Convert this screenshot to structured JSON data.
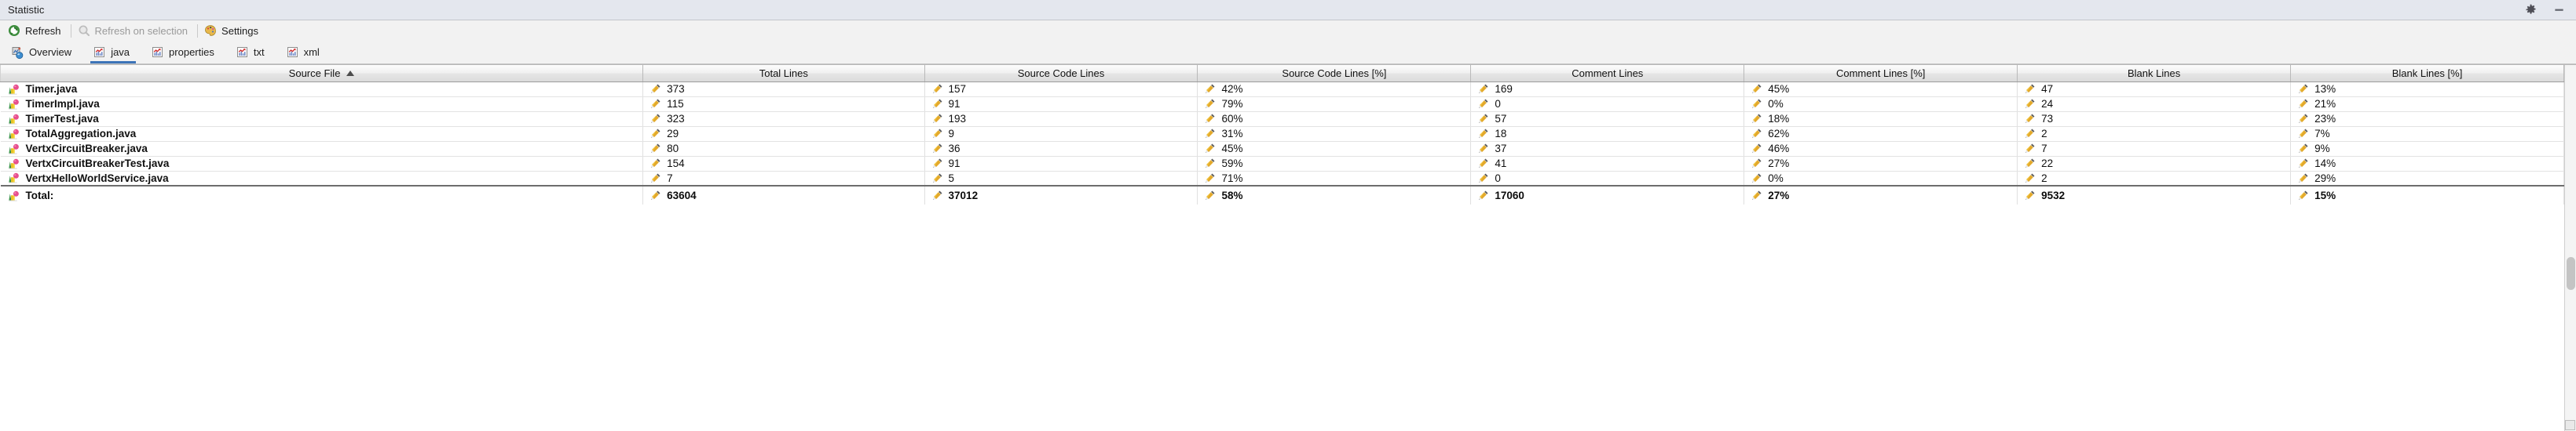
{
  "window": {
    "title": "Statistic",
    "controls": [
      {
        "name": "settings-gear",
        "icon": "gear-icon"
      },
      {
        "name": "minimize",
        "icon": "minimize-icon"
      }
    ]
  },
  "toolbar": {
    "items": [
      {
        "label": "Refresh",
        "icon": "refresh-icon",
        "enabled": true
      },
      {
        "label": "Refresh on selection",
        "icon": "search-icon",
        "enabled": false
      },
      {
        "label": "Settings",
        "icon": "palette-icon",
        "enabled": true
      }
    ]
  },
  "tabs": [
    {
      "label": "Overview",
      "icon": "overview-icon",
      "selected": false
    },
    {
      "label": "java",
      "icon": "chart-icon",
      "selected": true
    },
    {
      "label": "properties",
      "icon": "chart-icon",
      "selected": false
    },
    {
      "label": "txt",
      "icon": "chart-icon",
      "selected": false
    },
    {
      "label": "xml",
      "icon": "chart-icon",
      "selected": false
    }
  ],
  "table": {
    "sort_column": "Source File",
    "sort_direction": "asc",
    "columns": [
      "Source File",
      "Total Lines",
      "Source Code Lines",
      "Source Code Lines [%]",
      "Comment Lines",
      "Comment Lines [%]",
      "Blank Lines",
      "Blank Lines [%]"
    ],
    "rows": [
      {
        "file": "Timer.java",
        "total": "373",
        "source": "157",
        "source_pct": "42%",
        "comment": "169",
        "comment_pct": "45%",
        "blank": "47",
        "blank_pct": "13%"
      },
      {
        "file": "TimerImpl.java",
        "total": "115",
        "source": "91",
        "source_pct": "79%",
        "comment": "0",
        "comment_pct": "0%",
        "blank": "24",
        "blank_pct": "21%"
      },
      {
        "file": "TimerTest.java",
        "total": "323",
        "source": "193",
        "source_pct": "60%",
        "comment": "57",
        "comment_pct": "18%",
        "blank": "73",
        "blank_pct": "23%"
      },
      {
        "file": "TotalAggregation.java",
        "total": "29",
        "source": "9",
        "source_pct": "31%",
        "comment": "18",
        "comment_pct": "62%",
        "blank": "2",
        "blank_pct": "7%"
      },
      {
        "file": "VertxCircuitBreaker.java",
        "total": "80",
        "source": "36",
        "source_pct": "45%",
        "comment": "37",
        "comment_pct": "46%",
        "blank": "7",
        "blank_pct": "9%"
      },
      {
        "file": "VertxCircuitBreakerTest.java",
        "total": "154",
        "source": "91",
        "source_pct": "59%",
        "comment": "41",
        "comment_pct": "27%",
        "blank": "22",
        "blank_pct": "14%"
      },
      {
        "file": "VertxHelloWorldService.java",
        "total": "7",
        "source": "5",
        "source_pct": "71%",
        "comment": "0",
        "comment_pct": "0%",
        "blank": "2",
        "blank_pct": "29%"
      }
    ],
    "total_row": {
      "file": "Total:",
      "total": "63604",
      "source": "37012",
      "source_pct": "58%",
      "comment": "17060",
      "comment_pct": "27%",
      "blank": "9532",
      "blank_pct": "15%"
    }
  },
  "colors": {
    "accent": "#3d74b8",
    "titlebar_bg": "#e4e7ee",
    "toolbar_bg": "#f2f2f2",
    "table_bg": "#ffffff"
  }
}
